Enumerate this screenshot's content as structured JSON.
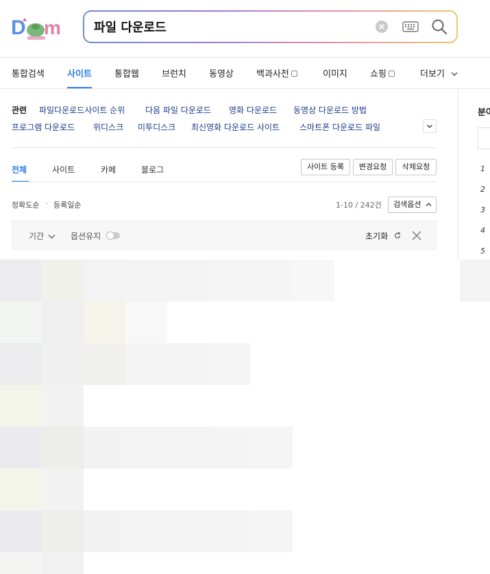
{
  "logo": {
    "name": "Daum"
  },
  "search": {
    "query": "파일 다운로드"
  },
  "nav": {
    "items": [
      {
        "label": "통합검색"
      },
      {
        "label": "사이트",
        "active": true
      },
      {
        "label": "통합웹"
      },
      {
        "label": "브런치"
      },
      {
        "label": "동영상"
      },
      {
        "label": "백과사전"
      },
      {
        "label": "이미지"
      },
      {
        "label": "쇼핑"
      },
      {
        "label": "더보기"
      }
    ]
  },
  "related": {
    "label": "관련",
    "items": [
      "파일다운로드사이트 순위",
      "다음 파일 다운로드",
      "영화 다운로드",
      "동영상 다운로드 방법",
      "프로그램 다운로드",
      "위디스크",
      "미투디스크",
      "최신영화 다운로드 사이트",
      "스마트폰 다운로드 파일"
    ]
  },
  "subtabs": [
    "전체",
    "사이트",
    "카페",
    "블로그"
  ],
  "site_buttons": [
    "사이트 등록",
    "변경요청",
    "삭제요청"
  ],
  "sort": {
    "accuracy": "정확도순",
    "dot": "·",
    "date": "등록일순"
  },
  "result_count": "1-10 / 242건",
  "search_options_label": "검색옵션",
  "options": {
    "period": "기간",
    "keep": "옵션유지",
    "reset": "초기화"
  },
  "right_panel": {
    "title": "분야",
    "ranks": [
      "1",
      "2",
      "3",
      "4",
      "5"
    ]
  },
  "colors": {
    "accent": "#2b7de9",
    "related_link": "#1e3a8a"
  }
}
